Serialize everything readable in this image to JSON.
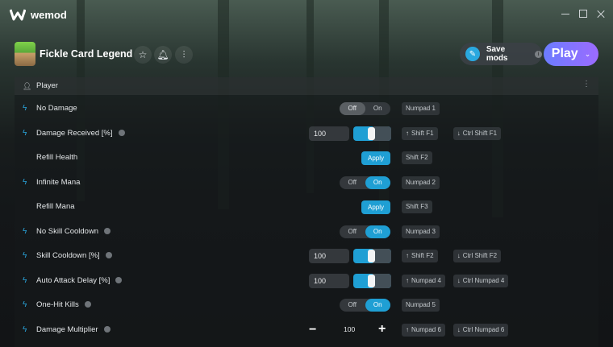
{
  "app": {
    "brand": "wemod"
  },
  "game": {
    "title": "Fickle Card Legend"
  },
  "header": {
    "save_mods_label": "Save mods",
    "play_label": "Play"
  },
  "section": {
    "title": "Player"
  },
  "toggle_labels": {
    "off": "Off",
    "on": "On"
  },
  "apply_label": "Apply",
  "rows": [
    {
      "label": "No Damage",
      "type": "toggle",
      "state": "off",
      "keys": [
        "Numpad 1"
      ]
    },
    {
      "label": "Damage Received [%]",
      "type": "slider",
      "info": true,
      "value": "100",
      "keys": [
        "Shift F1",
        "Ctrl Shift F1"
      ]
    },
    {
      "label": "Refill Health",
      "type": "button",
      "keys": [
        "Shift F2"
      ]
    },
    {
      "label": "Infinite Mana",
      "type": "toggle",
      "state": "on",
      "keys": [
        "Numpad 2"
      ]
    },
    {
      "label": "Refill Mana",
      "type": "button",
      "keys": [
        "Shift F3"
      ]
    },
    {
      "label": "No Skill Cooldown",
      "type": "toggle",
      "state": "on",
      "info": true,
      "keys": [
        "Numpad 3"
      ]
    },
    {
      "label": "Skill Cooldown [%]",
      "type": "slider",
      "info": true,
      "value": "100",
      "keys": [
        "Shift F2",
        "Ctrl Shift F2"
      ]
    },
    {
      "label": "Auto Attack Delay [%]",
      "type": "slider",
      "info": true,
      "value": "100",
      "keys": [
        "Numpad 4",
        "Ctrl Numpad 4"
      ]
    },
    {
      "label": "One-Hit Kills",
      "type": "toggle",
      "state": "on",
      "info": true,
      "keys": [
        "Numpad 5"
      ]
    },
    {
      "label": "Damage Multiplier",
      "type": "stepper",
      "info": true,
      "value": "100",
      "keys": [
        "Numpad 6",
        "Ctrl Numpad 6"
      ]
    }
  ],
  "colors": {
    "accent": "#1f9fd4",
    "play_gradient_start": "#6b7cff",
    "play_gradient_end": "#9c6bff"
  }
}
